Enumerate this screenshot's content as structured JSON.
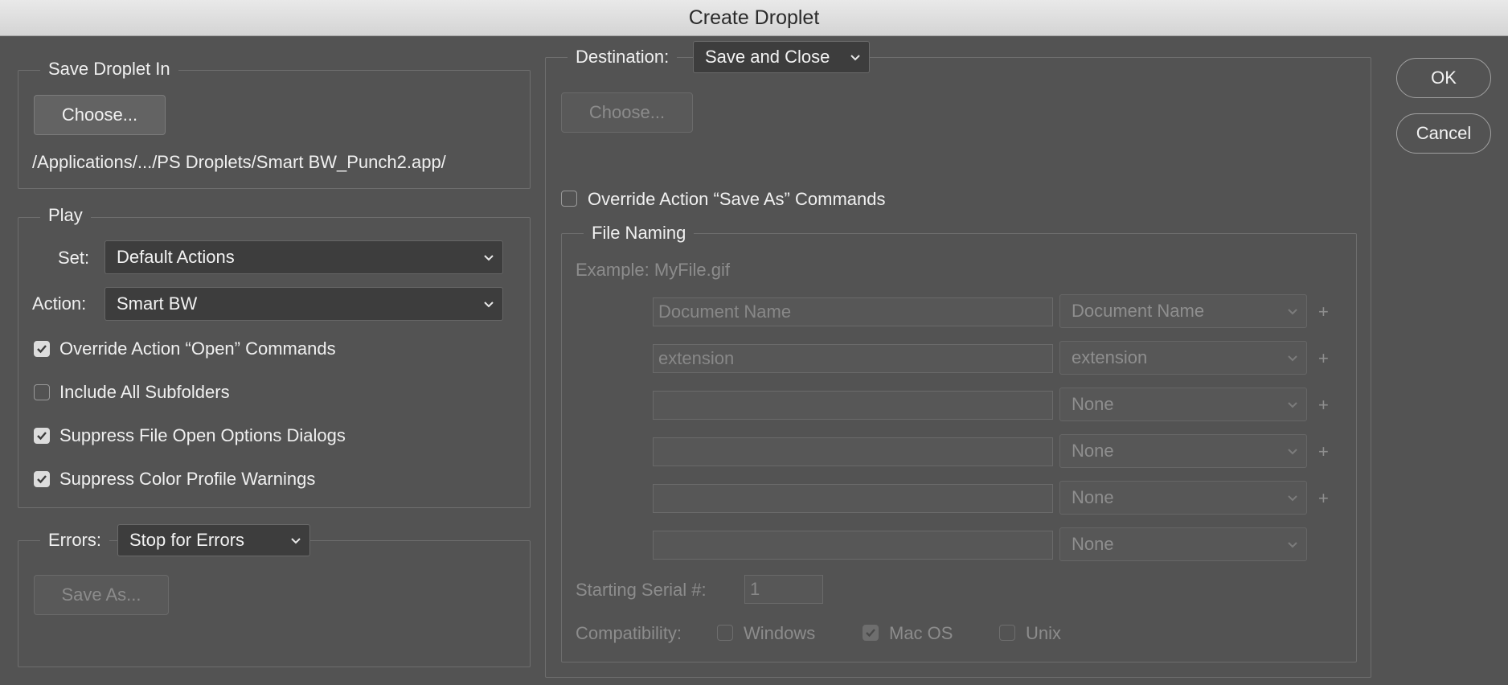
{
  "window": {
    "title": "Create Droplet"
  },
  "save_droplet_in": {
    "legend": "Save Droplet In",
    "choose_label": "Choose...",
    "path": "/Applications/.../PS Droplets/Smart BW_Punch2.app/"
  },
  "play": {
    "legend": "Play",
    "set_label": "Set:",
    "set_value": "Default Actions",
    "action_label": "Action:",
    "action_value": "Smart BW",
    "options": [
      {
        "label": "Override Action “Open” Commands",
        "checked": true
      },
      {
        "label": "Include All Subfolders",
        "checked": false
      },
      {
        "label": "Suppress File Open Options Dialogs",
        "checked": true
      },
      {
        "label": "Suppress Color Profile Warnings",
        "checked": true
      }
    ]
  },
  "errors": {
    "label": "Errors:",
    "value": "Stop for Errors",
    "save_as_label": "Save As..."
  },
  "destination": {
    "label": "Destination:",
    "value": "Save and Close",
    "choose_label": "Choose...",
    "override_save_as": {
      "label": "Override Action “Save As” Commands",
      "checked": false
    }
  },
  "file_naming": {
    "legend": "File Naming",
    "example": "Example: MyFile.gif",
    "rows": [
      {
        "text": "Document Name",
        "select": "Document Name",
        "plus": "+"
      },
      {
        "text": "extension",
        "select": "extension",
        "plus": "+"
      },
      {
        "text": "",
        "select": "None",
        "plus": "+"
      },
      {
        "text": "",
        "select": "None",
        "plus": "+"
      },
      {
        "text": "",
        "select": "None",
        "plus": "+"
      },
      {
        "text": "",
        "select": "None",
        "plus": ""
      }
    ],
    "serial_label": "Starting Serial #:",
    "serial_value": "1",
    "compat_label": "Compatibility:",
    "compat": [
      {
        "label": "Windows",
        "checked": false
      },
      {
        "label": "Mac OS",
        "checked": true
      },
      {
        "label": "Unix",
        "checked": false
      }
    ]
  },
  "buttons": {
    "ok": "OK",
    "cancel": "Cancel"
  }
}
